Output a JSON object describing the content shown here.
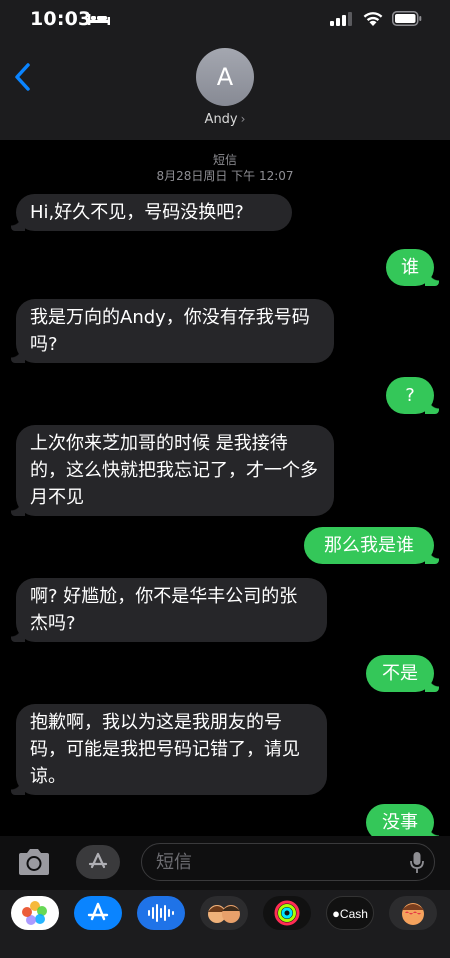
{
  "status": {
    "time": "10:03"
  },
  "contact": {
    "initial": "A",
    "name": "Andy",
    "chevron": "›"
  },
  "meta": {
    "service": "短信",
    "datetime": "8月28日周日 下午 12:07"
  },
  "messages": [
    {
      "dir": "in",
      "text": "Hi,好久不见，号码没换吧?"
    },
    {
      "dir": "out",
      "text": "谁"
    },
    {
      "dir": "in",
      "text": "我是万向的Andy，你没有存我号码吗?"
    },
    {
      "dir": "out",
      "text": "?"
    },
    {
      "dir": "in",
      "text": "上次你来芝加哥的时候 是我接待的，这么快就把我忘记了，才一个多月不见"
    },
    {
      "dir": "out",
      "text": "那么我是谁"
    },
    {
      "dir": "in",
      "text": "啊? 好尴尬，你不是华丰公司的张杰吗?"
    },
    {
      "dir": "out",
      "text": "不是"
    },
    {
      "dir": "in",
      "text": "抱歉啊，我以为这是我朋友的号码，可能是我把号码记错了，请见谅。"
    },
    {
      "dir": "out",
      "text": "没事"
    }
  ],
  "input": {
    "placeholder": "短信"
  },
  "app_strip": {
    "items": [
      "photos-icon",
      "app-store-icon",
      "audio-icon",
      "memoji-icon",
      "activity-icon",
      "apple-cash-icon",
      "memoji-stickers-icon"
    ],
    "cash_label": "Cash"
  },
  "colors": {
    "incoming": "#262629",
    "outgoing": "#34c759",
    "accent": "#0a84ff"
  }
}
